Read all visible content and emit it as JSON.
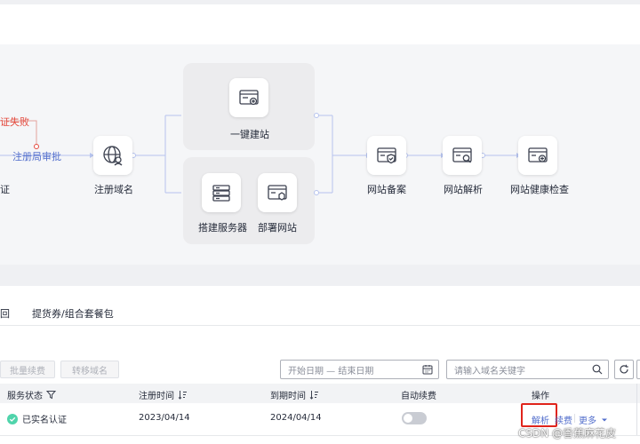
{
  "flow": {
    "red_fail_label": "证失败",
    "review_label": "注册局审批",
    "left_cut_label": "证",
    "nodes": {
      "register_domain": "注册域名",
      "one_click_site": "一键建站",
      "build_server": "搭建服务器",
      "deploy_site": "部署网站",
      "site_filing": "网站备案",
      "site_dns": "网站解析",
      "site_health": "网站健康检查"
    },
    "colors": {
      "accent": "#526ecc",
      "error": "#e4493d",
      "connector": "#b6c3ee"
    }
  },
  "tabs": {
    "items": [
      {
        "label": "回"
      },
      {
        "label": "提货券/组合套餐包"
      }
    ]
  },
  "toolbar": {
    "batch_renew": "批量续费",
    "transfer_domain": "转移域名",
    "date_range_placeholder": "开始日期 — 结束日期",
    "search_placeholder": "请输入域名关键字"
  },
  "table": {
    "headers": {
      "service_status": "服务状态",
      "register_time": "注册时间",
      "expire_time": "到期时间",
      "auto_renew": "自动续费",
      "actions": "操作"
    },
    "rows": [
      {
        "status": "已实名认证",
        "register_time": "2023/04/14",
        "expire_time": "2024/04/14",
        "auto_renew_on": false,
        "action_resolve": "解析",
        "action_renew": "续费",
        "action_more": "更多"
      }
    ]
  },
  "watermark": "CSDN @香蕉麻花皮"
}
